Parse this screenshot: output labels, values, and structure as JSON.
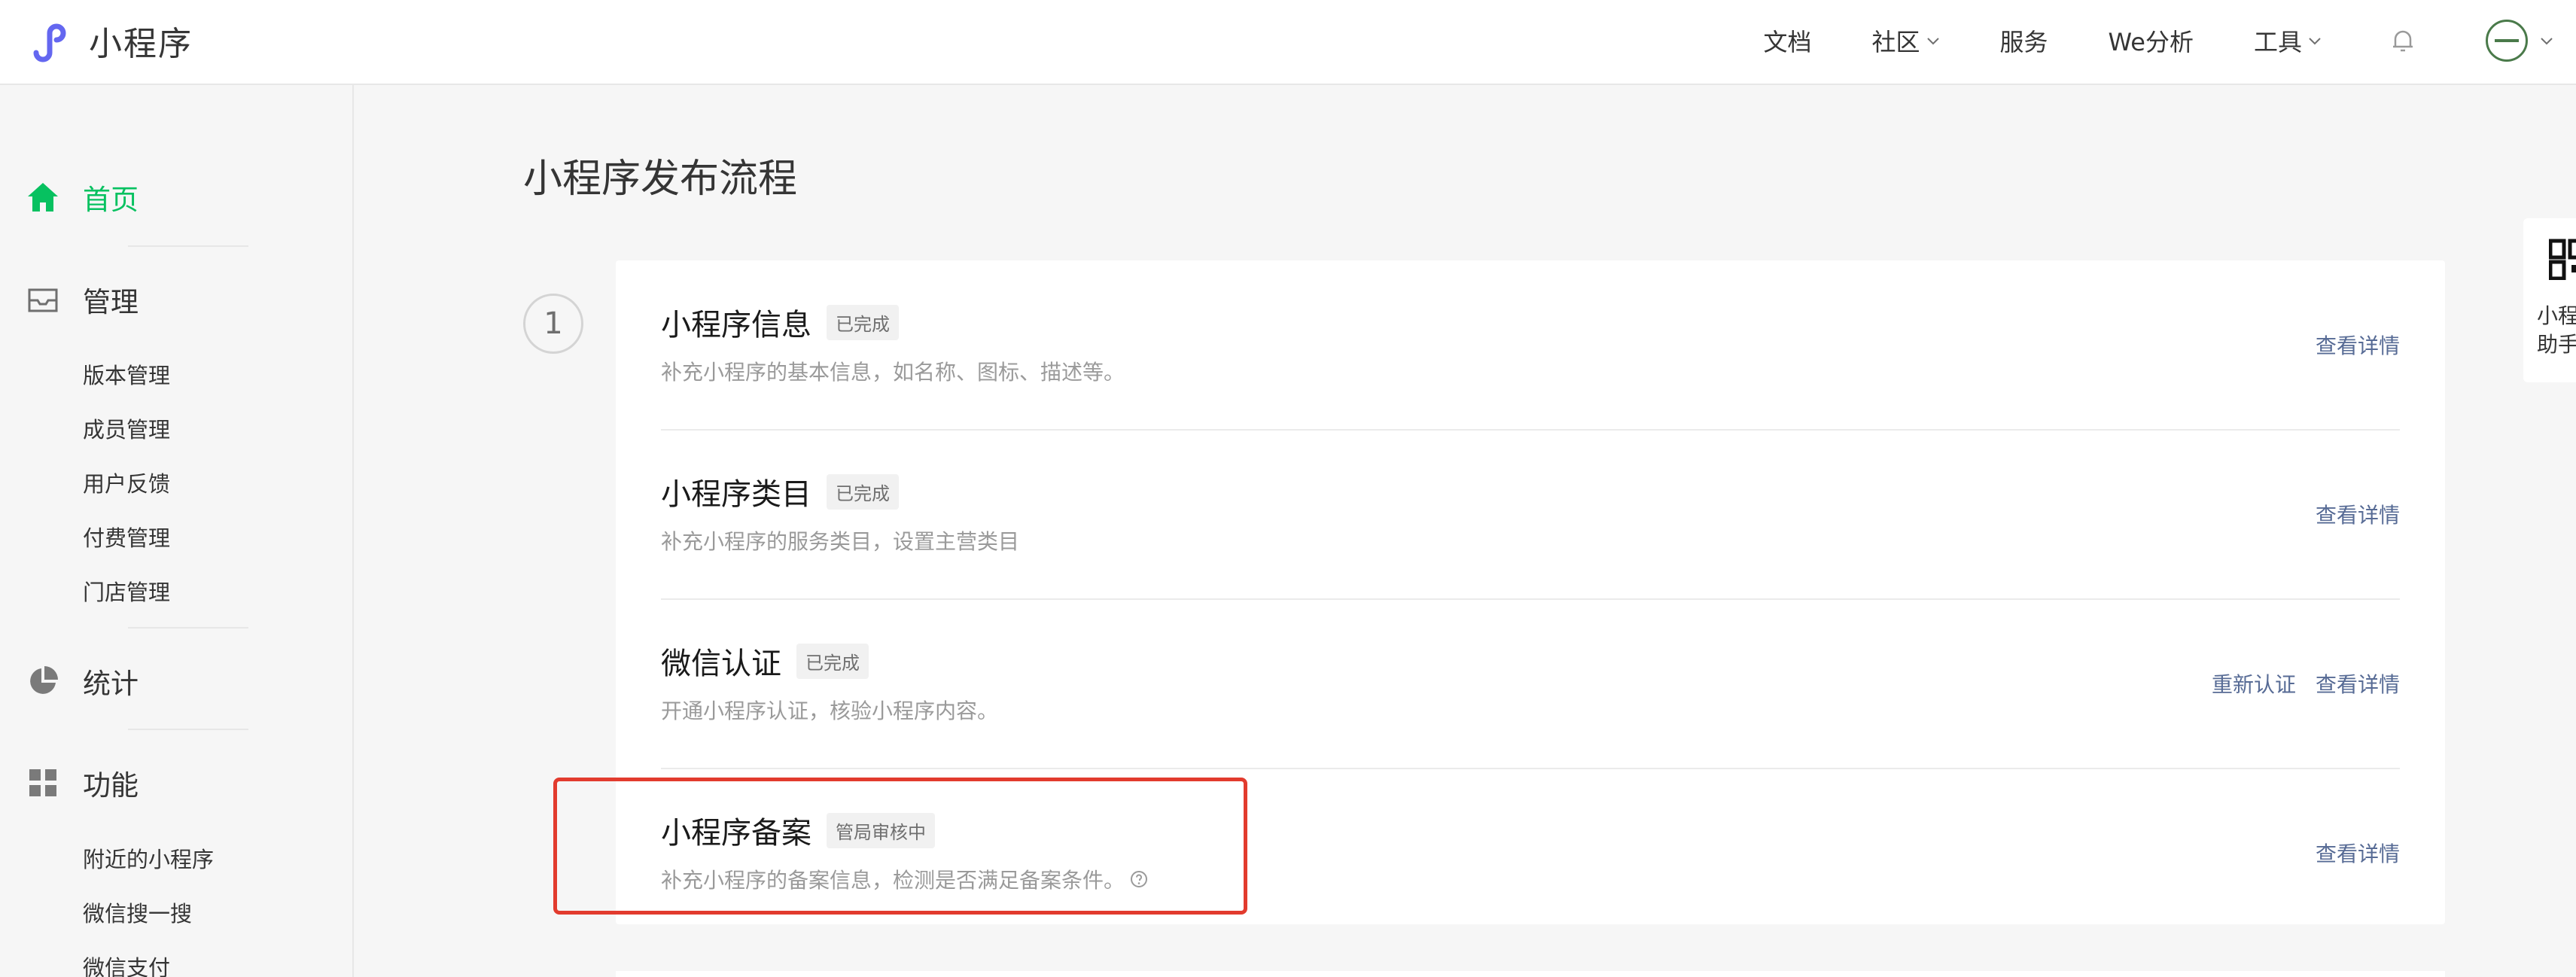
{
  "header": {
    "logo_text": "小程序",
    "nav": {
      "docs": "文档",
      "community": "社区",
      "services": "服务",
      "analytics": "We分析",
      "tools": "工具"
    },
    "accent_color": "#6467f0"
  },
  "sidebar": {
    "home": "首页",
    "manage": {
      "label": "管理",
      "items": [
        "版本管理",
        "成员管理",
        "用户反馈",
        "付费管理",
        "门店管理"
      ]
    },
    "stats": "统计",
    "features": {
      "label": "功能",
      "items": [
        "附近的小程序",
        "微信搜一搜",
        "微信支付"
      ]
    },
    "active_color": "#07c160"
  },
  "main": {
    "title": "小程序发布流程",
    "step_number": "1",
    "steps": [
      {
        "title": "小程序信息",
        "badge": "已完成",
        "desc": "补充小程序的基本信息，如名称、图标、描述等。",
        "actions": [
          "查看详情"
        ]
      },
      {
        "title": "小程序类目",
        "badge": "已完成",
        "desc": "补充小程序的服务类目，设置主营类目",
        "actions": [
          "查看详情"
        ]
      },
      {
        "title": "微信认证",
        "badge": "已完成",
        "desc": "开通小程序认证，核验小程序内容。",
        "actions": [
          "重新认证",
          "查看详情"
        ]
      },
      {
        "title": "小程序备案",
        "badge": "管局审核中",
        "desc": "补充小程序的备案信息，检测是否满足备案条件。",
        "actions": [
          "查看详情"
        ]
      }
    ],
    "link_color": "#576b95",
    "highlight_color": "#e23b2e"
  },
  "side_panel": {
    "line1": "小程",
    "line2": "助手"
  }
}
